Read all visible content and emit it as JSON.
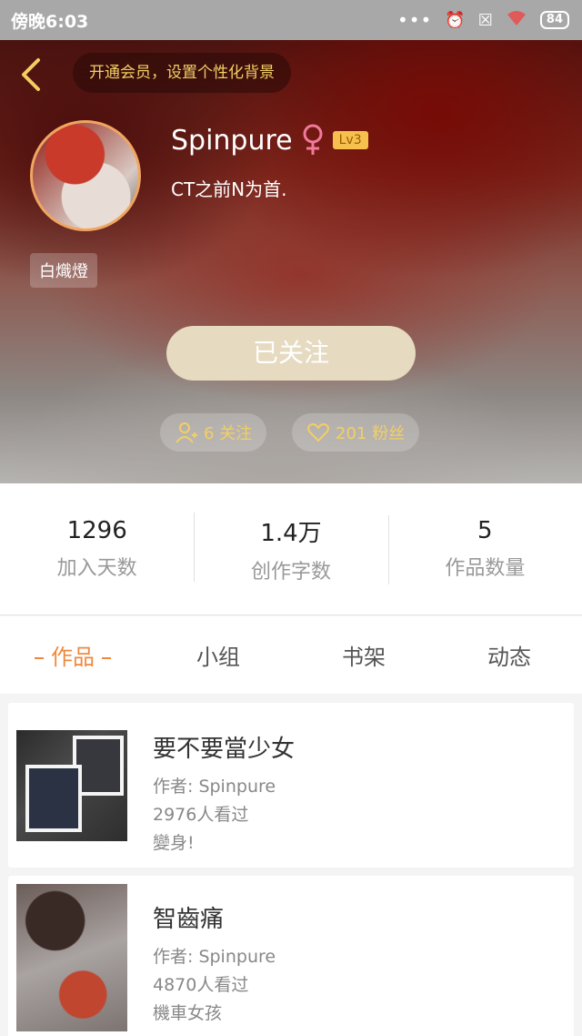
{
  "status_bar": {
    "time": "傍晚6:03",
    "battery": "84"
  },
  "header": {
    "vip_banner": "开通会员，设置个性化背景",
    "username": "Spinpure",
    "level": "Lv3",
    "bio": "CT之前N为首.",
    "tag": "白熾燈",
    "follow_button": "已关注",
    "following_label": "6 关注",
    "fans_label": "201 粉丝"
  },
  "stats": [
    {
      "value": "1296",
      "label": "加入天数"
    },
    {
      "value": "1.4万",
      "label": "创作字数"
    },
    {
      "value": "5",
      "label": "作品数量"
    }
  ],
  "tabs": [
    "作品",
    "小组",
    "书架",
    "动态"
  ],
  "works": [
    {
      "title": "要不要當少女",
      "author": "作者: Spinpure",
      "views": "2976人看过",
      "desc": "變身!"
    },
    {
      "title": "智齒痛",
      "author": "作者: Spinpure",
      "views": "4870人看过",
      "desc": "機車女孩"
    }
  ],
  "colors": {
    "accent": "#f0883c",
    "gold": "#f3cf62",
    "follow_bg": "#e6dac0",
    "gender": "#f07a9a"
  }
}
